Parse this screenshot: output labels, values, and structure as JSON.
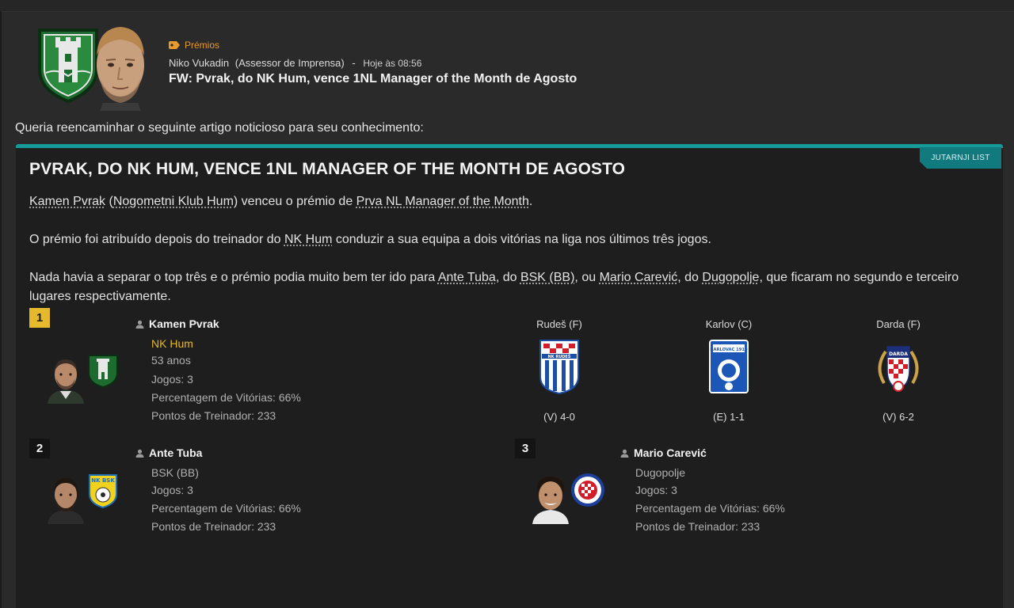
{
  "message": {
    "category": "Prémios",
    "sender_name": "Niko Vukadin",
    "sender_role": "(Assessor de Imprensa)",
    "separator": "-",
    "time": "Hoje às 08:56",
    "subject": "FW: Pvrak, do NK Hum, vence 1NL Manager of the Month de Agosto",
    "intro": "Queria reencaminhar o seguinte artigo noticioso para seu conhecimento:"
  },
  "article": {
    "source": "JUTARNJI LIST",
    "headline": "PVRAK, DO NK HUM, VENCE 1NL MANAGER OF THE MONTH DE AGOSTO",
    "p1": {
      "link1": "Kamen Pvrak",
      "t1": " (",
      "link2": "Nogometni Klub Hum",
      "t2": ") venceu o prémio de ",
      "link3": "Prva NL Manager of the Month",
      "t3": "."
    },
    "p2": {
      "t1": "O prémio foi atribuído depois do treinador do ",
      "link1": "NK Hum",
      "t2": " conduzir a sua equipa a dois vitórias na liga nos últimos três jogos."
    },
    "p3": {
      "t1": "Nada havia a separar o top três e o prémio podia muito bem ter ido para ",
      "link1": "Ante Tuba",
      "t2": ", do ",
      "link2": "BSK (BB)",
      "t3": ", ou ",
      "link3": "Mario Carević",
      "t4": ", do ",
      "link4": "Dugopolje",
      "t5": ", que ficaram no segundo e terceiro lugares respectivamente."
    }
  },
  "ranking": [
    {
      "rank": "1",
      "name": "Kamen Pvrak",
      "club": "NK Hum",
      "age": "53 anos",
      "games": "Jogos: 3",
      "win_pct": "Percentagem de Vitórias: 66%",
      "points": "Pontos de Treinador: 233"
    },
    {
      "rank": "2",
      "name": "Ante Tuba",
      "club": "BSK (BB)",
      "games": "Jogos: 3",
      "win_pct": "Percentagem de Vitórias: 66%",
      "points": "Pontos de Treinador: 233"
    },
    {
      "rank": "3",
      "name": "Mario Carević",
      "club": "Dugopolje",
      "games": "Jogos: 3",
      "win_pct": "Percentagem de Vitórias: 66%",
      "points": "Pontos de Treinador: 233"
    }
  ],
  "matches": [
    {
      "opponent": "Rudeš (F)",
      "result": "(V) 4-0",
      "logo_text": "NK RUDEŠ"
    },
    {
      "opponent": "Karlov (C)",
      "result": "(E) 1-1",
      "logo_text": "KARLOVAC 1919"
    },
    {
      "opponent": "Darda (F)",
      "result": "(V) 6-2",
      "logo_text": "DARDA"
    }
  ],
  "colors": {
    "accent_teal": "#179a9a",
    "badge_teal": "#107a7e",
    "gold": "#e5b92b",
    "category_orange": "#e79a2e"
  },
  "icons": [
    "tag-icon",
    "person-icon",
    "club-crest",
    "manager-face"
  ]
}
